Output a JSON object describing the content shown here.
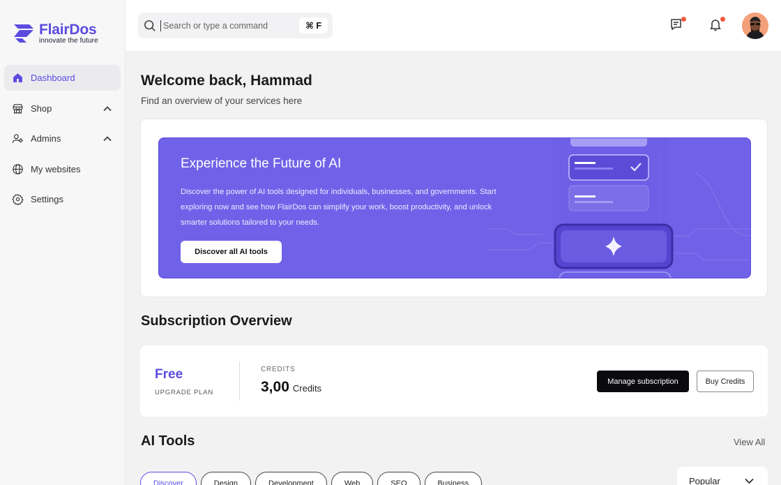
{
  "brand": {
    "name": "FlairDos",
    "tagline": "innovate the future",
    "accent": "#5b4be0"
  },
  "sidebar": {
    "items": [
      {
        "label": "Dashboard",
        "icon": "home-icon",
        "active": true
      },
      {
        "label": "Shop",
        "icon": "store-icon",
        "expandable": true
      },
      {
        "label": "Admins",
        "icon": "user-settings-icon",
        "expandable": true
      },
      {
        "label": "My websites",
        "icon": "globe-icon"
      },
      {
        "label": "Settings",
        "icon": "gear-icon"
      }
    ]
  },
  "topbar": {
    "search_placeholder": "Search or type a command",
    "shortcut": "⌘ F",
    "icons": [
      "messages-icon",
      "bell-icon"
    ],
    "notification_color": "#f0583c"
  },
  "main": {
    "welcome_title": "Welcome back, Hammad",
    "welcome_subtitle": "Find an overview of your services here",
    "hero": {
      "title": "Experience the Future of AI",
      "description": "Discover the power of AI tools designed for individuals, businesses, and governments. Start exploring now and see how FlairDos can simplify your work, boost productivity, and unlock smarter solutions tailored to your needs.",
      "button": "Discover all AI tools",
      "background": "#7062e8"
    },
    "subscription": {
      "title": "Subscription Overview",
      "plan": "Free",
      "plan_sub": "UPGRADE PLAN",
      "credits_label": "CREDITS",
      "credits_value": "3,00",
      "credits_unit": "Credits",
      "manage_button": "Manage subscription",
      "buy_button": "Buy Credits"
    },
    "ai_tools": {
      "title": "AI Tools",
      "view_all": "View All",
      "chips": [
        "Discover",
        "Design",
        "Development",
        "Web",
        "SEO",
        "Business"
      ],
      "active_chip": 0,
      "sort_value": "Popular"
    }
  }
}
